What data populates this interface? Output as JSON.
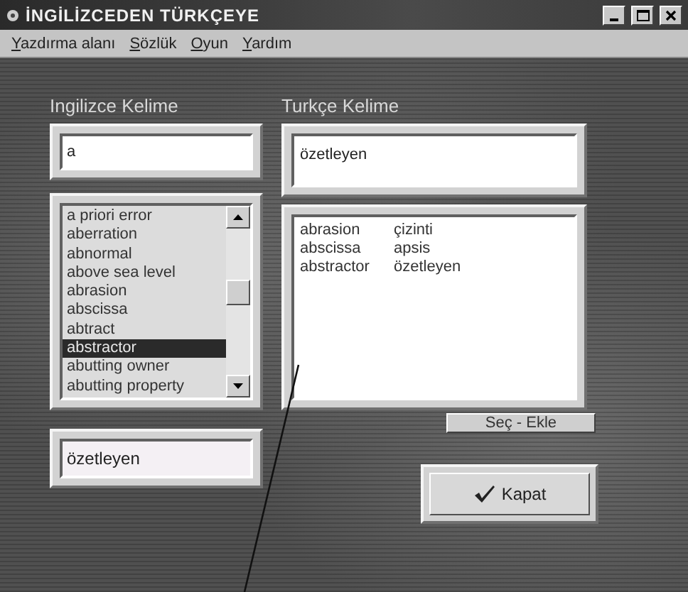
{
  "window": {
    "title": "İNGİLİZCEDEN TÜRKÇEYE"
  },
  "menu": [
    {
      "label": "Yazdırma alanı"
    },
    {
      "label": "Sözlük"
    },
    {
      "label": "Oyun"
    },
    {
      "label": "Yardım"
    }
  ],
  "english_word": {
    "label": "Ingilizce Kelime",
    "value": "a"
  },
  "word_list": [
    {
      "text": "a priori error",
      "selected": false
    },
    {
      "text": "aberration",
      "selected": false
    },
    {
      "text": "abnormal",
      "selected": false
    },
    {
      "text": "above sea level",
      "selected": false
    },
    {
      "text": "abrasion",
      "selected": false
    },
    {
      "text": "abscissa",
      "selected": false
    },
    {
      "text": "abtract",
      "selected": false
    },
    {
      "text": "abstractor",
      "selected": true
    },
    {
      "text": "abutting owner",
      "selected": false
    },
    {
      "text": "abutting property",
      "selected": false
    }
  ],
  "meaning_field": {
    "value": "özetleyen"
  },
  "turkish_word": {
    "label": "Turkçe Kelime",
    "value": "özetleyen"
  },
  "results": [
    {
      "english": "abrasion",
      "turkish": "çizinti"
    },
    {
      "english": "abscissa",
      "turkish": "apsis"
    },
    {
      "english": "abstractor",
      "turkish": "özetleyen"
    }
  ],
  "select_add_button": "Seç - Ekle",
  "close_button": "Kapat"
}
